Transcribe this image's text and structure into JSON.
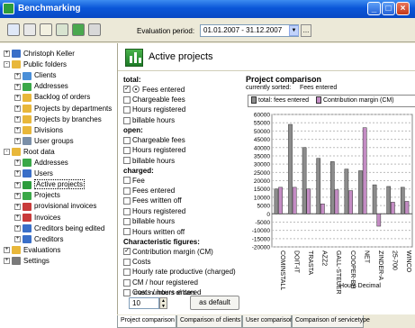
{
  "window": {
    "title": "Benchmarking"
  },
  "toolbar": {
    "eval_label": "Evaluation period:",
    "eval_value": "01.01.2007 - 31.12.2007",
    "more_label": "..."
  },
  "tree": [
    {
      "label": "Christoph Keller",
      "depth": 0,
      "exp": "+",
      "icon": "user-icon",
      "color": "#3a6fc8"
    },
    {
      "label": "Public folders",
      "depth": 0,
      "exp": "-",
      "icon": "folder-icon",
      "color": "#e8b73a"
    },
    {
      "label": "Clients",
      "depth": 1,
      "exp": "+",
      "icon": "clients-icon",
      "color": "#4a8fd8"
    },
    {
      "label": "Addresses",
      "depth": 1,
      "exp": "+",
      "icon": "addresses-icon",
      "color": "#3aa848"
    },
    {
      "label": "Backlog of orders",
      "depth": 1,
      "exp": "+",
      "icon": "folder-icon",
      "color": "#e8b73a"
    },
    {
      "label": "Projects by departments",
      "depth": 1,
      "exp": "+",
      "icon": "folder-icon",
      "color": "#e8b73a"
    },
    {
      "label": "Projects by branches",
      "depth": 1,
      "exp": "+",
      "icon": "folder-icon",
      "color": "#e8b73a"
    },
    {
      "label": "Divisions",
      "depth": 1,
      "exp": "+",
      "icon": "folder-icon",
      "color": "#e8b73a"
    },
    {
      "label": "User groups",
      "depth": 1,
      "exp": "+",
      "icon": "users-icon",
      "color": "#7a8fa8"
    },
    {
      "label": "Root data",
      "depth": 0,
      "exp": "-",
      "icon": "folder-icon",
      "color": "#e8b73a"
    },
    {
      "label": "Addresses",
      "depth": 1,
      "exp": "+",
      "icon": "addresses-icon",
      "color": "#3aa848"
    },
    {
      "label": "Users",
      "depth": 1,
      "exp": "+",
      "icon": "user-icon",
      "color": "#3a6fc8"
    },
    {
      "label": "Active projects",
      "depth": 1,
      "exp": "+",
      "icon": "chart-icon",
      "color": "#2d9c3d",
      "selected": true
    },
    {
      "label": "Projects",
      "depth": 1,
      "exp": "+",
      "icon": "projects-icon",
      "color": "#3aa848"
    },
    {
      "label": "provisional invoices",
      "depth": 1,
      "exp": "+",
      "icon": "invoice-icon",
      "color": "#c83a3a"
    },
    {
      "label": "Invoices",
      "depth": 1,
      "exp": "+",
      "icon": "invoice-icon",
      "color": "#c83a3a"
    },
    {
      "label": "Creditors being edited",
      "depth": 1,
      "exp": "+",
      "icon": "creditor-icon",
      "color": "#3a6fc8"
    },
    {
      "label": "Creditors",
      "depth": 1,
      "exp": "+",
      "icon": "creditor-icon",
      "color": "#3a6fc8"
    },
    {
      "label": "Evaluations",
      "depth": 0,
      "exp": "+",
      "icon": "folder-icon",
      "color": "#e8b73a"
    },
    {
      "label": "Settings",
      "depth": 0,
      "exp": "+",
      "icon": "settings-icon",
      "color": "#7a7a7a"
    }
  ],
  "main": {
    "title": "Active projects"
  },
  "options": [
    {
      "kind": "group",
      "label": "total:"
    },
    {
      "kind": "radio",
      "label": "Fees entered",
      "checked": true
    },
    {
      "kind": "check",
      "label": "Chargeable fees",
      "checked": false
    },
    {
      "kind": "check",
      "label": "Hours registered",
      "checked": false
    },
    {
      "kind": "check",
      "label": "billable hours",
      "checked": false
    },
    {
      "kind": "group",
      "label": "open:"
    },
    {
      "kind": "check",
      "label": "Chargeable fees",
      "checked": false
    },
    {
      "kind": "check",
      "label": "Hours registered",
      "checked": false
    },
    {
      "kind": "check",
      "label": "billable hours",
      "checked": false
    },
    {
      "kind": "group",
      "label": "charged:"
    },
    {
      "kind": "check",
      "label": "Fee",
      "checked": false
    },
    {
      "kind": "check",
      "label": "Fees entered",
      "checked": false
    },
    {
      "kind": "check",
      "label": "Fees written off",
      "checked": false
    },
    {
      "kind": "check",
      "label": "Hours registered",
      "checked": false
    },
    {
      "kind": "check",
      "label": "billable hours",
      "checked": false
    },
    {
      "kind": "check",
      "label": "Hours written off",
      "checked": false
    },
    {
      "kind": "group",
      "label": "Characteristic figures:"
    },
    {
      "kind": "check",
      "label": "Contribution margin (CM)",
      "checked": true
    },
    {
      "kind": "check",
      "label": "Costs",
      "checked": false
    },
    {
      "kind": "check",
      "label": "Hourly rate productive (charged)",
      "checked": false
    },
    {
      "kind": "check",
      "label": "CM / hour registered",
      "checked": false
    },
    {
      "kind": "check",
      "label": "Costs / hours entered",
      "checked": false
    }
  ],
  "max_bars": {
    "label": "max. numbers of bars",
    "value": "10"
  },
  "default_button": "as default",
  "chart_header": {
    "title": "Project comparison",
    "sorted_label": "currently sorted:",
    "sorted_value": "Fees entered"
  },
  "chart_data": {
    "type": "bar",
    "xlabel": "Hours Decimal",
    "categories": [
      "COMINSTALL",
      "DOIT-IT",
      "TRASTA",
      "AZZ2",
      "GALL-STEUER",
      "COOPER-BH",
      "NET",
      "ZINDER-A",
      "25-700",
      "WINCO"
    ],
    "series": [
      {
        "name": "total: fees entered",
        "color": "#8c8c8c",
        "values": [
          15000,
          54000,
          40000,
          33500,
          31500,
          27000,
          26000,
          17500,
          16500,
          16000
        ]
      },
      {
        "name": "Contribution margin (CM)",
        "color": "#c48cc4",
        "values": [
          16000,
          16000,
          15000,
          6000,
          14500,
          14000,
          52000,
          -7500,
          7000,
          7500
        ]
      }
    ],
    "ylim": [
      -20000,
      60000
    ],
    "yticks": [
      "60000",
      "55000",
      "50000",
      "45000",
      "40000",
      "35000",
      "30000",
      "25000",
      "20000",
      "15000",
      "10000",
      "5000",
      "0",
      "-5000",
      "-10000",
      "-15000",
      "-20000"
    ],
    "grid": true,
    "legend": "top"
  },
  "tabs": [
    "Project comparison",
    "Comparison of clients",
    "User comparison",
    "Comparison of servicetype"
  ]
}
